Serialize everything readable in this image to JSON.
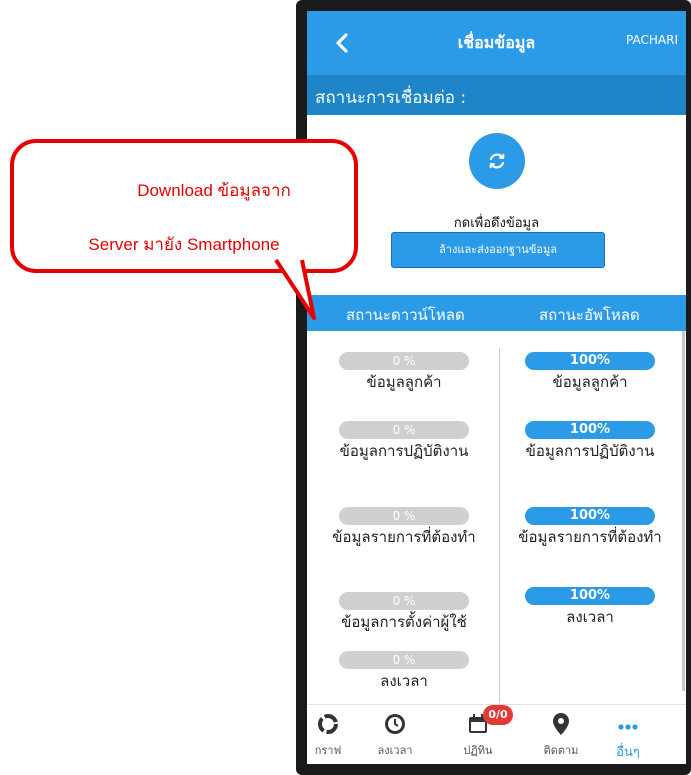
{
  "callout": {
    "line1": "Download ข้อมูลจาก",
    "line2": "Server มายัง Smartphone"
  },
  "appbar": {
    "title": "เชื่อมข้อมูล",
    "user": "PACHARI",
    "back_icon": "chevron-left-icon"
  },
  "connection": {
    "title": "สถานะการเชื่อมต่อ :",
    "sync_icon": "sync-icon",
    "sync_label": "กดเพื่อดึงข้อมูล",
    "reset_button": "ล้างและส่งออกฐานข้อมูล"
  },
  "status": {
    "download_title": "สถานะดาวน์โหลด",
    "upload_title": "สถานะอัพโหลด"
  },
  "download_items": [
    {
      "progress": "0 %",
      "label": "ข้อมูลลูกค้า"
    },
    {
      "progress": "0 %",
      "label": "ข้อมูลการปฏิบัติงาน"
    },
    {
      "progress": "0 %",
      "label": "ข้อมูลรายการที่ต้องทำ"
    },
    {
      "progress": "0 %",
      "label": "ข้อมูลการตั้งค่าผู้ใช้"
    },
    {
      "progress": "0 %",
      "label": "ลงเวลา"
    }
  ],
  "upload_items": [
    {
      "progress": "100%",
      "label": "ข้อมูลลูกค้า"
    },
    {
      "progress": "100%",
      "label": "ข้อมูลการปฏิบัติงาน"
    },
    {
      "progress": "100%",
      "label": "ข้อมูลรายการที่ต้องทำ"
    },
    {
      "progress": "100%",
      "label": "ลงเวลา"
    }
  ],
  "bottom_nav": [
    {
      "label": "กราฟ",
      "icon": "chart-ring-icon"
    },
    {
      "label": "ลงเวลา",
      "icon": "clock-icon"
    },
    {
      "label": "ปฏิทิน",
      "icon": "calendar-icon",
      "badge": "0/0"
    },
    {
      "label": "ติดตาม",
      "icon": "map-pin-icon"
    },
    {
      "label": "อื่นๆ",
      "icon": "more-icon",
      "active": true
    }
  ],
  "colors": {
    "primary": "#2b9be8",
    "band_dark": "#1e86c8",
    "callout_red": "#e60000",
    "badge_red": "#e53935"
  }
}
